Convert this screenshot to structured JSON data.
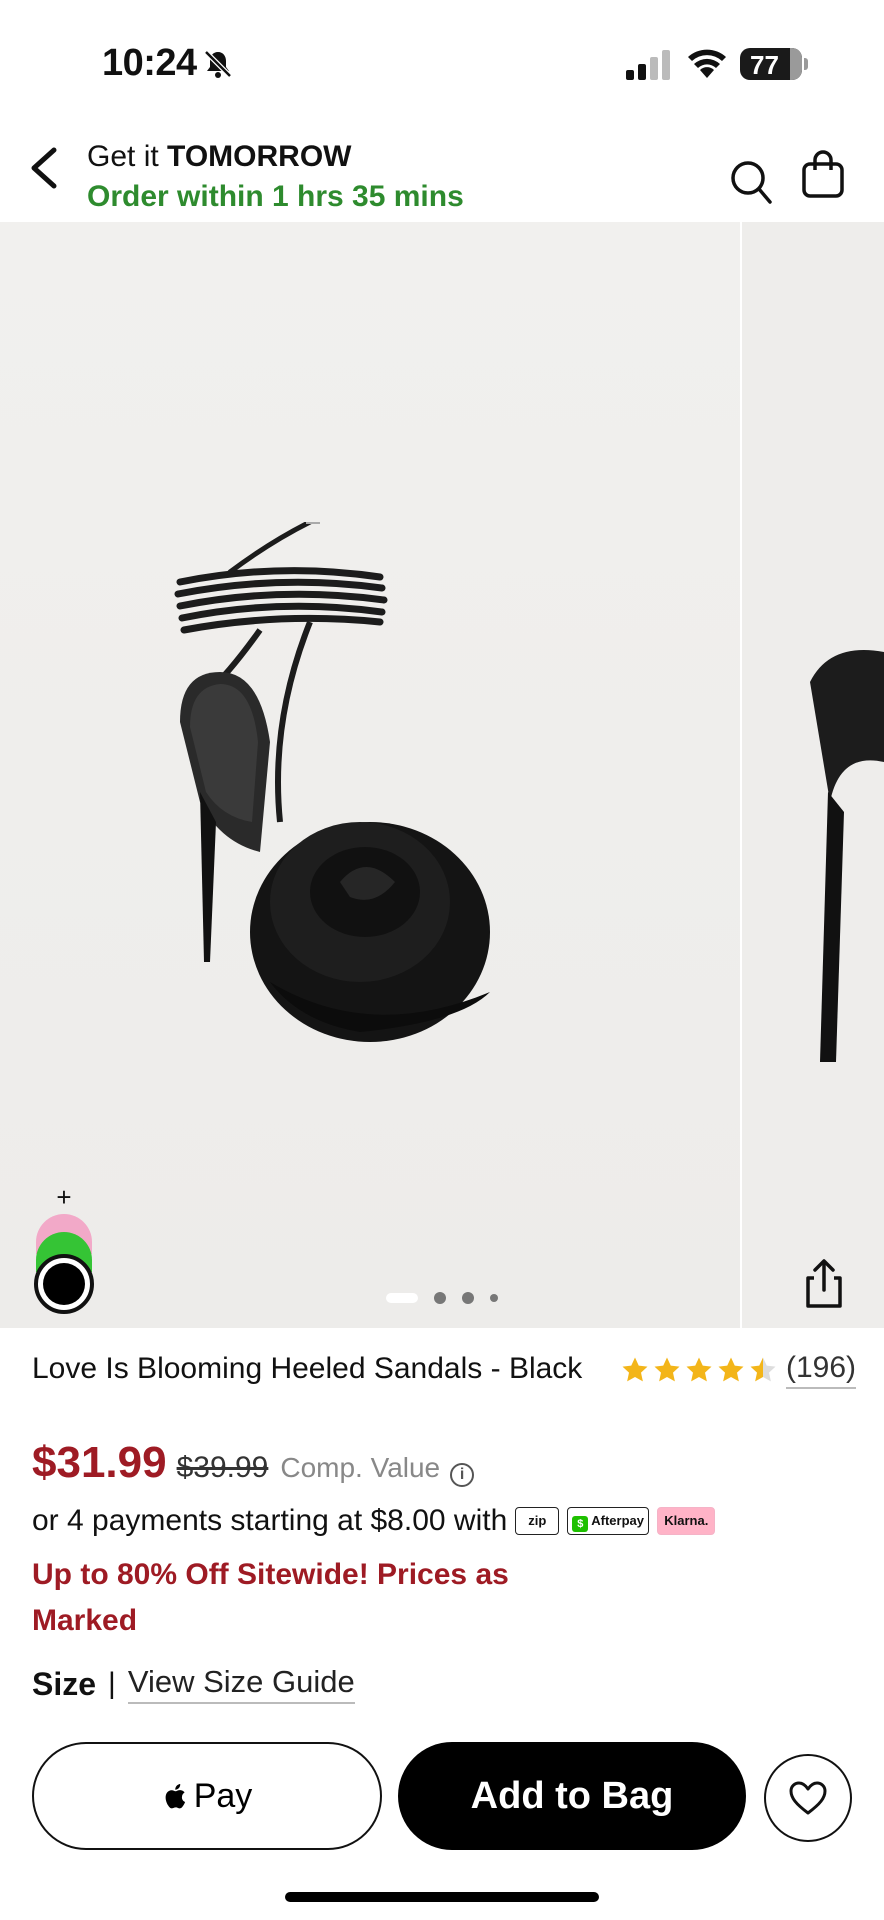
{
  "status_bar": {
    "time": "10:24",
    "battery": "77",
    "icons": [
      "bell-slash-icon",
      "signal-icon",
      "wifi-icon",
      "battery-icon"
    ]
  },
  "header": {
    "get_it": "Get it",
    "when": "TOMORROW",
    "order_within": "Order within 1 hrs 35 mins",
    "icons": [
      "chevron-left-icon",
      "search-icon",
      "shopping-bag-icon"
    ]
  },
  "gallery": {
    "image_count": 4,
    "active_index": 0,
    "add_swatch_symbol": "+",
    "swatches": [
      "#f2a9c8",
      "#35c435",
      "#000000"
    ],
    "icons": [
      "share-icon"
    ]
  },
  "product": {
    "title": "Love Is Blooming Heeled Sandals - Black",
    "rating": 4.5,
    "review_count": "(196)",
    "price": "$31.99",
    "was_price": "$39.99",
    "comp_label": "Comp. Value",
    "payments_text": "or 4 payments starting at $8.00 with",
    "pay_badges": [
      "zip",
      "Afterpay",
      "Klarna."
    ],
    "promo": "Up to 80% Off Sitewide! Prices as Marked",
    "size_label": "Size",
    "size_sep": "|",
    "size_guide": "View Size Guide"
  },
  "actions": {
    "apple_pay": "Pay",
    "add_to_bag": "Add to Bag",
    "icons": [
      "apple-icon",
      "heart-icon"
    ]
  },
  "colors": {
    "sale_red": "#9e1b24",
    "delivery_green": "#2e8b2e",
    "star_gold": "#f3b519"
  }
}
